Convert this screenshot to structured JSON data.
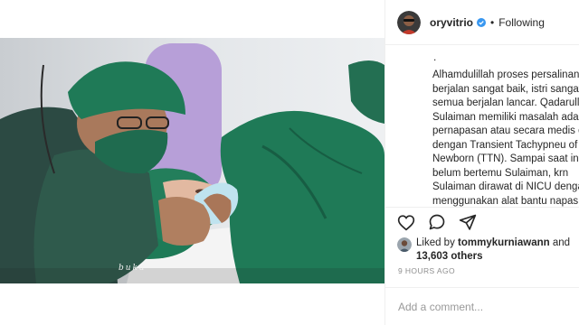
{
  "post": {
    "username": "oryvitrio",
    "separator": "•",
    "follow_status": "Following",
    "watermark": "buka",
    "caption_leading": ".",
    "caption": "Alhamdulillah proses persalinan berjalan sangat baik, istri sangat sehat, semua berjalan lancar. Qadarullah, Sulaiman memiliki masalah adaptasi pernapasan atau secara medis disebut dengan Transient Tachypneu of the Newborn (TTN). Sampai saat ini istri belum bertemu Sulaiman, krn Sulaiman dirawat di NICU dengan menggunakan alat bantu napas."
  },
  "likes": {
    "prefix": "Liked by",
    "liker": "tommykurniawann",
    "conjunction": "and",
    "others": "13,603 others"
  },
  "timestamp": "9 HOURS AGO",
  "comment": {
    "placeholder": "Add a comment..."
  },
  "icons": {
    "verified": "verified-badge-icon",
    "like": "heart-icon",
    "comment": "comment-bubble-icon",
    "share": "paper-plane-icon"
  },
  "colors": {
    "verified": "#3897f0",
    "text": "#262626",
    "muted": "#8e8e8e",
    "scrubs": "#1f6b4f"
  }
}
